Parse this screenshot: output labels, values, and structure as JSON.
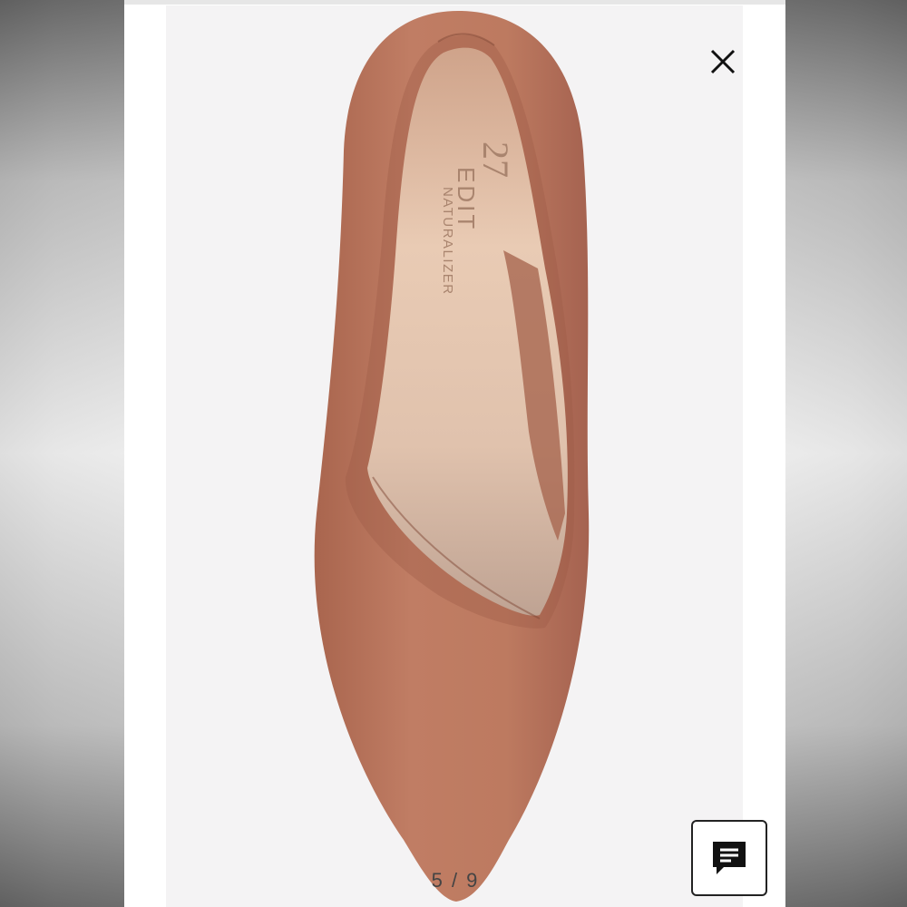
{
  "viewer": {
    "counter": "5 / 9",
    "close_icon": "close-icon",
    "chat_icon": "chat-icon"
  },
  "product_image": {
    "insole_brand_line1": "EDIT",
    "insole_brand_line2": "NATURALIZER",
    "insole_logo_number": "27",
    "colors": {
      "leather": "#b9765e",
      "insole": "#e3c3aa",
      "background": "#f4f3f4"
    }
  }
}
